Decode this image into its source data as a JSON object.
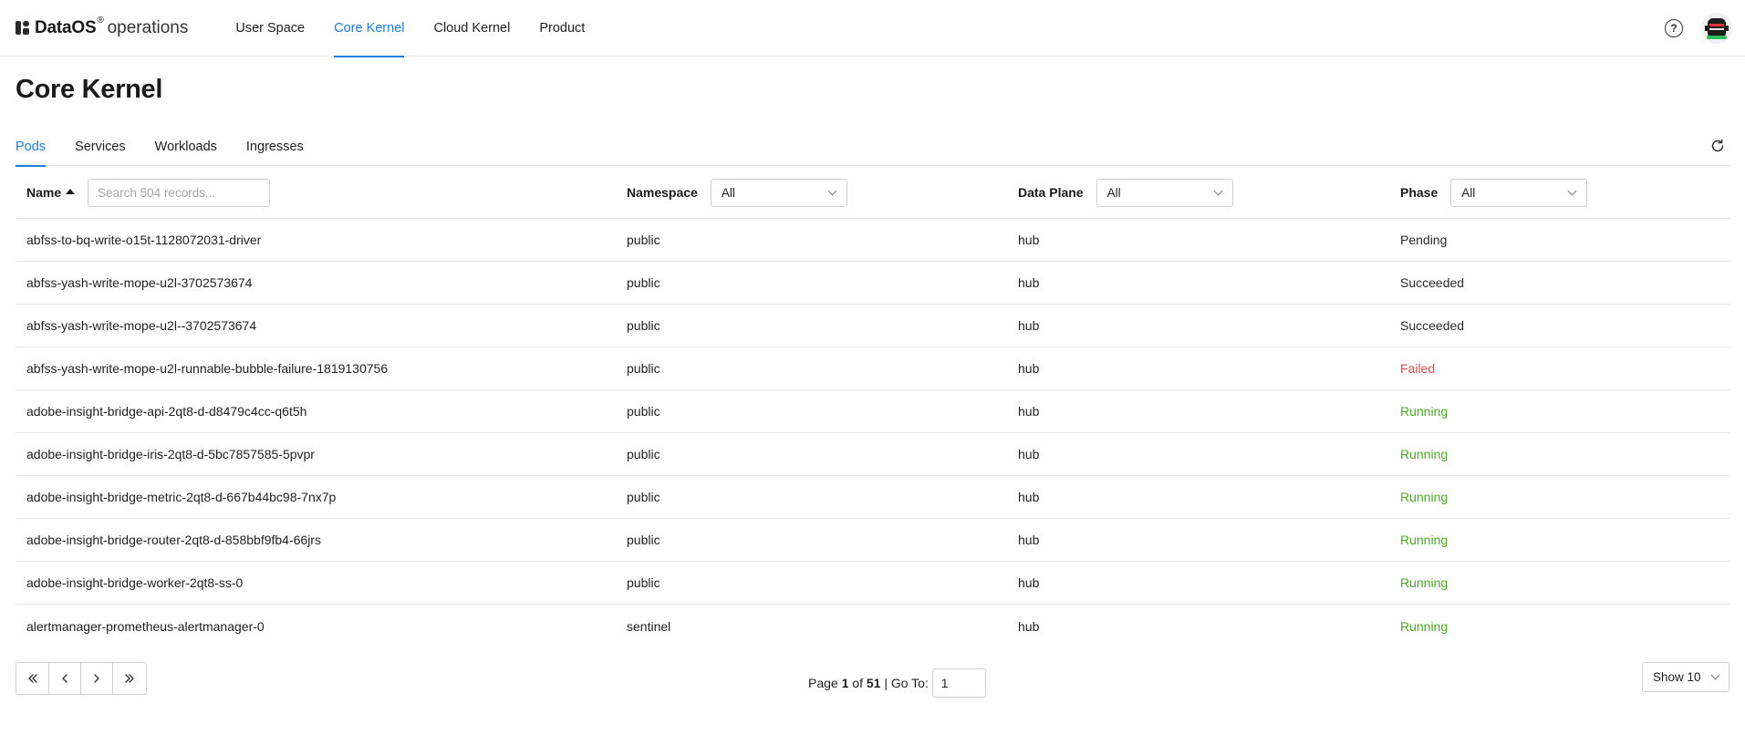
{
  "brand": {
    "name": "DataOS",
    "reg": "®",
    "sub": "operations"
  },
  "nav": [
    {
      "label": "User Space",
      "active": false
    },
    {
      "label": "Core Kernel",
      "active": true
    },
    {
      "label": "Cloud Kernel",
      "active": false
    },
    {
      "label": "Product",
      "active": false
    }
  ],
  "help_glyph": "?",
  "page_title": "Core Kernel",
  "tabs": [
    {
      "label": "Pods",
      "active": true
    },
    {
      "label": "Services",
      "active": false
    },
    {
      "label": "Workloads",
      "active": false
    },
    {
      "label": "Ingresses",
      "active": false
    }
  ],
  "columns": {
    "name": "Name",
    "namespace": "Namespace",
    "data_plane": "Data Plane",
    "phase": "Phase"
  },
  "filters": {
    "search_placeholder": "Search 504 records...",
    "namespace": "All",
    "data_plane": "All",
    "phase": "All"
  },
  "rows": [
    {
      "name": "abfss-to-bq-write-o15t-1128072031-driver",
      "namespace": "public",
      "data_plane": "hub",
      "phase": "Pending",
      "phase_class": "phase-pending"
    },
    {
      "name": "abfss-yash-write-mope-u2l-3702573674",
      "namespace": "public",
      "data_plane": "hub",
      "phase": "Succeeded",
      "phase_class": "phase-succeeded"
    },
    {
      "name": "abfss-yash-write-mope-u2l--3702573674",
      "namespace": "public",
      "data_plane": "hub",
      "phase": "Succeeded",
      "phase_class": "phase-succeeded"
    },
    {
      "name": "abfss-yash-write-mope-u2l-runnable-bubble-failure-1819130756",
      "namespace": "public",
      "data_plane": "hub",
      "phase": "Failed",
      "phase_class": "phase-failed"
    },
    {
      "name": "adobe-insight-bridge-api-2qt8-d-d8479c4cc-q6t5h",
      "namespace": "public",
      "data_plane": "hub",
      "phase": "Running",
      "phase_class": "phase-running"
    },
    {
      "name": "adobe-insight-bridge-iris-2qt8-d-5bc7857585-5pvpr",
      "namespace": "public",
      "data_plane": "hub",
      "phase": "Running",
      "phase_class": "phase-running"
    },
    {
      "name": "adobe-insight-bridge-metric-2qt8-d-667b44bc98-7nx7p",
      "namespace": "public",
      "data_plane": "hub",
      "phase": "Running",
      "phase_class": "phase-running"
    },
    {
      "name": "adobe-insight-bridge-router-2qt8-d-858bbf9fb4-66jrs",
      "namespace": "public",
      "data_plane": "hub",
      "phase": "Running",
      "phase_class": "phase-running"
    },
    {
      "name": "adobe-insight-bridge-worker-2qt8-ss-0",
      "namespace": "public",
      "data_plane": "hub",
      "phase": "Running",
      "phase_class": "phase-running"
    },
    {
      "name": "alertmanager-prometheus-alertmanager-0",
      "namespace": "sentinel",
      "data_plane": "hub",
      "phase": "Running",
      "phase_class": "phase-running"
    }
  ],
  "pagination": {
    "first": "«",
    "prev": "‹",
    "next": "›",
    "last": "»",
    "page_label": "Page",
    "current_page": "1",
    "of_label": "of",
    "total_pages": "51",
    "goto_label": "| Go To:",
    "goto_value": "1",
    "show_label": "Show 10"
  },
  "colors": {
    "accent": "#1e7be0",
    "running": "#4caa27",
    "failed": "#e24a4a"
  },
  "icons": {
    "help": "help-circle-icon",
    "refresh": "refresh-icon",
    "sort": "sort-ascending-icon"
  }
}
